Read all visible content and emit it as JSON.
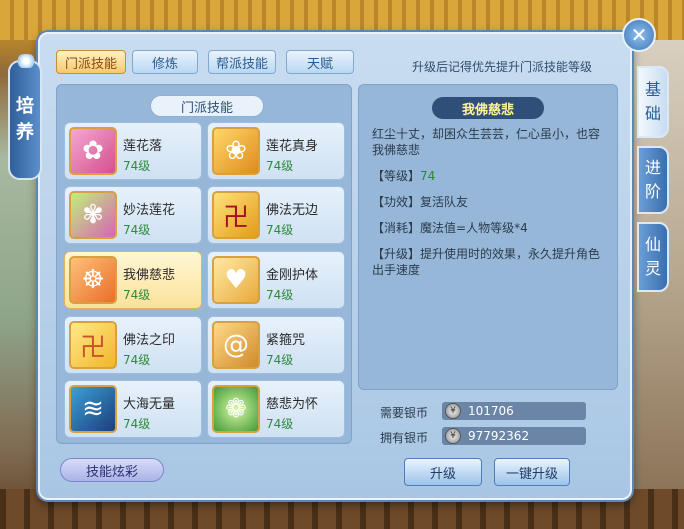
{
  "side_tab": {
    "label_1": "培",
    "label_2": "养"
  },
  "right_tabs": [
    {
      "label_1": "基",
      "label_2": "础"
    },
    {
      "label_1": "进",
      "label_2": "阶"
    },
    {
      "label_1": "仙",
      "label_2": "灵"
    }
  ],
  "close_icon": "close-icon",
  "tabs": [
    {
      "label": "门派技能"
    },
    {
      "label": "修炼"
    },
    {
      "label": "帮派技能"
    },
    {
      "label": "天赋"
    }
  ],
  "hint": "升级后记得优先提升门派技能等级",
  "skill_section_title": "门派技能",
  "skills": [
    {
      "name": "莲花落",
      "level": "74级",
      "icon": "lotus-icon"
    },
    {
      "name": "莲花真身",
      "level": "74级",
      "icon": "golden-lotus-icon"
    },
    {
      "name": "妙法莲花",
      "level": "74级",
      "icon": "lotus-flowers-icon"
    },
    {
      "name": "佛法无边",
      "level": "74级",
      "icon": "swastika-icon"
    },
    {
      "name": "我佛慈悲",
      "level": "74级",
      "icon": "buddha-icon"
    },
    {
      "name": "金刚护体",
      "level": "74级",
      "icon": "heart-shield-icon"
    },
    {
      "name": "佛法之印",
      "level": "74级",
      "icon": "scroll-icon"
    },
    {
      "name": "紧箍咒",
      "level": "74级",
      "icon": "spiral-icon"
    },
    {
      "name": "大海无量",
      "level": "74级",
      "icon": "wave-icon"
    },
    {
      "name": "慈悲为怀",
      "level": "74级",
      "icon": "lotus-glow-icon"
    }
  ],
  "detail": {
    "title": "我佛慈悲",
    "intro": "红尘十丈，却困众生芸芸，仁心虽小，也容我佛慈悲",
    "level_label": "【等级】",
    "level_value": "74",
    "effect_label": "【功效】",
    "effect_value": "复活队友",
    "cost_label": "【消耗】",
    "cost_value": "魔法值=人物等级*4",
    "upgrade_label": "【升级】",
    "upgrade_value": "提升使用时的效果，永久提升角色出手速度"
  },
  "currency": {
    "need_label": "需要银币",
    "need_value": "101706",
    "have_label": "拥有银币",
    "have_value": "97792362",
    "coin_icon": "silver-coin-icon"
  },
  "buttons": {
    "showoff": "技能炫彩",
    "upgrade": "升级",
    "upgrade_all": "一键升级"
  }
}
